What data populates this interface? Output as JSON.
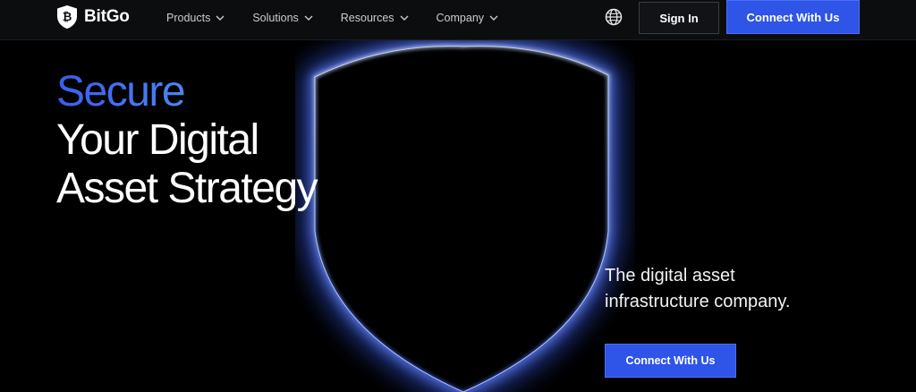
{
  "nav": {
    "brand": "BitGo",
    "menu": [
      {
        "label": "Products"
      },
      {
        "label": "Solutions"
      },
      {
        "label": "Resources"
      },
      {
        "label": "Company"
      }
    ],
    "globe_icon": "globe-icon",
    "signin_label": "Sign In",
    "connect_label": "Connect With Us"
  },
  "hero": {
    "accent_line": "Secure",
    "line2": "Your Digital",
    "line3": "Asset Strategy"
  },
  "tagline": {
    "line1": "The digital asset",
    "line2": "infrastructure company."
  },
  "cta": {
    "connect_label": "Connect With Us"
  },
  "colors": {
    "background": "#000000",
    "nav_background": "#0c0d0f",
    "accent_blue": "#2e54e8",
    "glow_blue": "#3d63ff",
    "gradient_start": "#3b5cf0",
    "gradient_end": "#5cc4f5"
  }
}
